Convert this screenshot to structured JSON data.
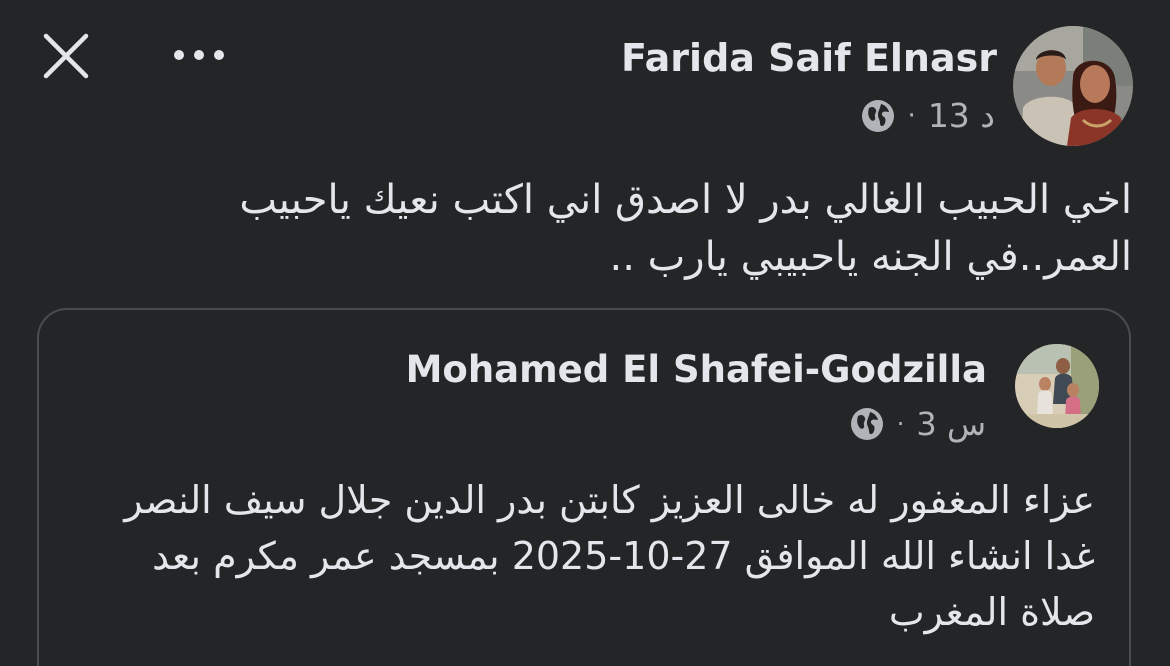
{
  "header": {
    "close_icon": "close-icon",
    "more_icon": "more-options-icon"
  },
  "post": {
    "author": "Farida Saif Elnasr",
    "time": "13 د",
    "separator": "·",
    "audience_icon": "globe-icon",
    "text": "اخي الحبيب الغالي بدر لا اصدق اني اكتب نعيك ياحبيب العمر..في الجنه ياحبيبي يارب .."
  },
  "shared_post": {
    "author": "Mohamed El Shafei-Godzilla",
    "time": "3 س",
    "separator": "·",
    "audience_icon": "globe-icon",
    "text": "عزاء المغفور له خالى العزيز كابتن بدر الدين جلال سيف النصر غدا انشاء الله الموافق 27-10-2025 بمسجد عمر مكرم بعد صلاة المغرب"
  },
  "colors": {
    "background": "#242526",
    "text_primary": "#e4e6eb",
    "text_secondary": "#b0b3b8",
    "card_border": "#4a4b4d"
  }
}
